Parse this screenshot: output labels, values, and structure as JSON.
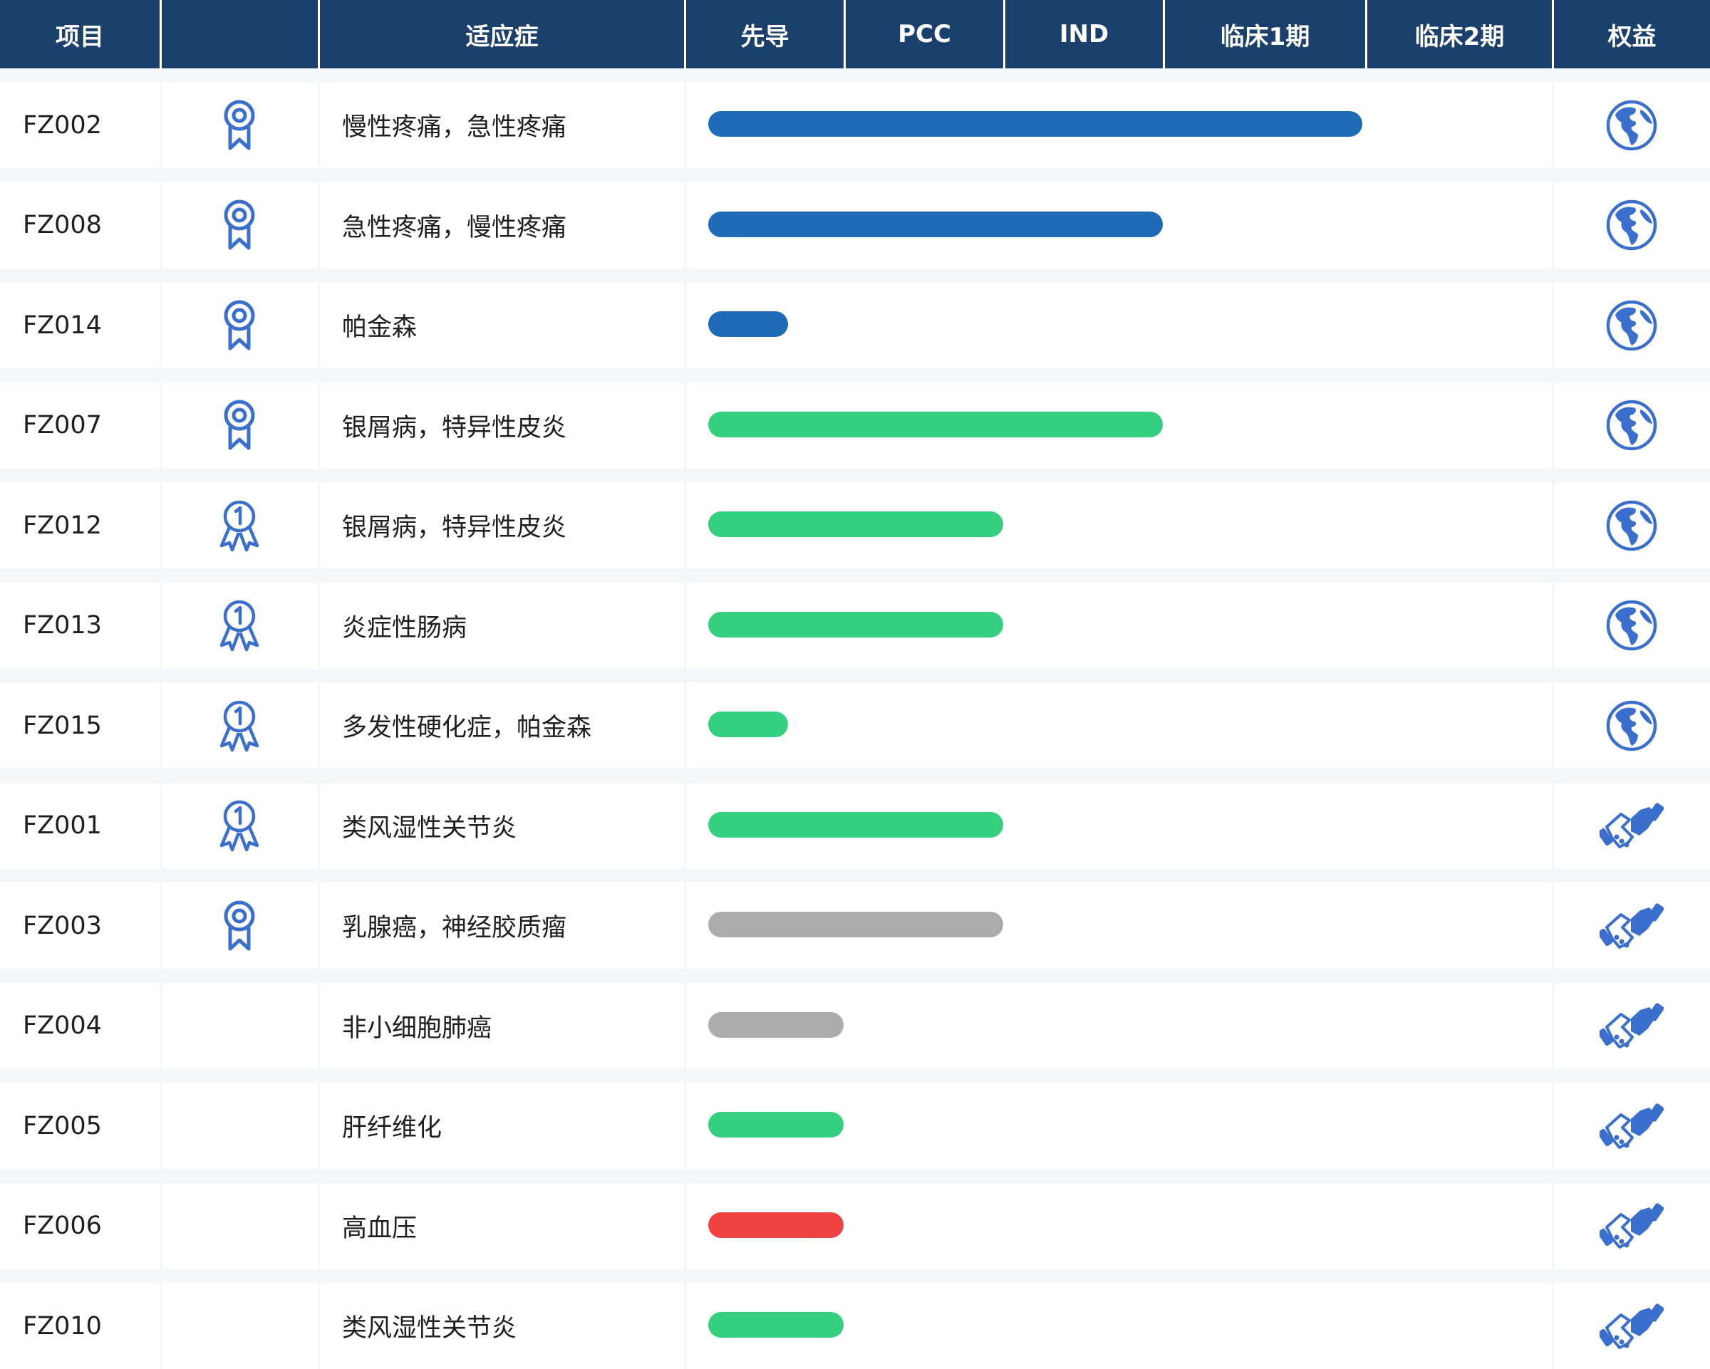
{
  "header": {
    "project": "项目",
    "indication": "适应症",
    "lead": "先导",
    "pcc": "PCC",
    "ind": "IND",
    "phase1": "临床1期",
    "phase2": "临床2期",
    "rights": "权益"
  },
  "colors": {
    "header_bg": "#1c406c",
    "blue": "#1f6bb8",
    "green": "#34d07f",
    "gray": "#acacac",
    "red": "#ef4343",
    "icon_blue": "#3a6fcd"
  },
  "stage_scale": [
    "先导",
    "PCC",
    "IND",
    "临床1期",
    "临床2期"
  ],
  "rows": [
    {
      "id": "FZ002",
      "badge": "ribbon-icon",
      "indication": "慢性疼痛，急性疼痛",
      "progress_stage": 4.1,
      "bar_color": "blue",
      "rights_icon": "globe-icon"
    },
    {
      "id": "FZ008",
      "badge": "ribbon-icon",
      "indication": "急性疼痛，慢性疼痛",
      "progress_stage": 2.85,
      "bar_color": "blue",
      "rights_icon": "globe-icon"
    },
    {
      "id": "FZ014",
      "badge": "ribbon-icon",
      "indication": "帕金森",
      "progress_stage": 0.5,
      "bar_color": "blue",
      "rights_icon": "globe-icon"
    },
    {
      "id": "FZ007",
      "badge": "ribbon-icon",
      "indication": "银屑病，特异性皮炎",
      "progress_stage": 2.85,
      "bar_color": "green",
      "rights_icon": "globe-icon"
    },
    {
      "id": "FZ012",
      "badge": "first-medal-icon",
      "indication": "银屑病，特异性皮炎",
      "progress_stage": 1.85,
      "bar_color": "green",
      "rights_icon": "globe-icon"
    },
    {
      "id": "FZ013",
      "badge": "first-medal-icon",
      "indication": "炎症性肠病",
      "progress_stage": 1.85,
      "bar_color": "green",
      "rights_icon": "globe-icon"
    },
    {
      "id": "FZ015",
      "badge": "first-medal-icon",
      "indication": "多发性硬化症，帕金森",
      "progress_stage": 0.5,
      "bar_color": "green",
      "rights_icon": "globe-icon"
    },
    {
      "id": "FZ001",
      "badge": "first-medal-icon",
      "indication": "类风湿性关节炎",
      "progress_stage": 1.85,
      "bar_color": "green",
      "rights_icon": "handshake-icon"
    },
    {
      "id": "FZ003",
      "badge": "ribbon-icon",
      "indication": "乳腺癌，神经胶质瘤",
      "progress_stage": 1.85,
      "bar_color": "gray",
      "rights_icon": "handshake-icon"
    },
    {
      "id": "FZ004",
      "badge": "",
      "indication": "非小细胞肺癌",
      "progress_stage": 0.85,
      "bar_color": "gray",
      "rights_icon": "handshake-icon"
    },
    {
      "id": "FZ005",
      "badge": "",
      "indication": "肝纤维化",
      "progress_stage": 0.85,
      "bar_color": "green",
      "rights_icon": "handshake-icon"
    },
    {
      "id": "FZ006",
      "badge": "",
      "indication": "高血压",
      "progress_stage": 0.85,
      "bar_color": "red",
      "rights_icon": "handshake-icon"
    },
    {
      "id": "FZ010",
      "badge": "",
      "indication": "类风湿性关节炎",
      "progress_stage": 0.85,
      "bar_color": "green",
      "rights_icon": "handshake-icon"
    }
  ]
}
